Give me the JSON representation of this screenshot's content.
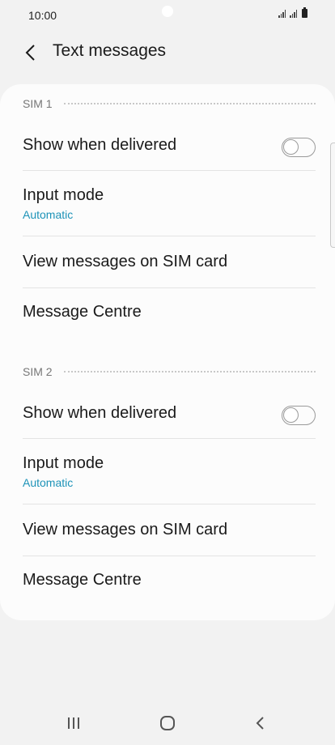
{
  "status_bar": {
    "time": "10:00"
  },
  "header": {
    "title": "Text messages"
  },
  "sim1": {
    "label": "SIM 1",
    "rows": [
      {
        "title": "Show when delivered",
        "toggle": false
      },
      {
        "title": "Input mode",
        "subtitle": "Automatic"
      },
      {
        "title": "View messages on SIM card"
      },
      {
        "title": "Message Centre"
      }
    ]
  },
  "sim2": {
    "label": "SIM 2",
    "rows": [
      {
        "title": "Show when delivered",
        "toggle": false
      },
      {
        "title": "Input mode",
        "subtitle": "Automatic"
      },
      {
        "title": "View messages on SIM card"
      },
      {
        "title": "Message Centre"
      }
    ]
  },
  "colors": {
    "accent": "#1d93b8",
    "background": "#f2f2f2",
    "card": "#fcfcfc"
  },
  "icons": {
    "back": "chevron-left-icon",
    "recents": "recents-icon",
    "home": "home-icon",
    "nav_back": "nav-back-icon"
  }
}
